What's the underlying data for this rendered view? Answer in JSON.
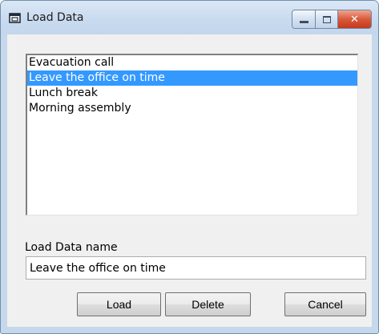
{
  "window": {
    "title": "Load Data",
    "icon": "app-window-icon",
    "controls": {
      "minimize_icon": "minimize-icon",
      "maximize_icon": "maximize-icon",
      "close_symbol": "✕"
    }
  },
  "list": {
    "items": [
      {
        "label": "Evacuation call",
        "selected": false
      },
      {
        "label": "Leave the office on time",
        "selected": true
      },
      {
        "label": "Lunch break",
        "selected": false
      },
      {
        "label": "Morning assembly",
        "selected": false
      }
    ]
  },
  "name_field": {
    "label": "Load Data name",
    "value": "Leave the office on time"
  },
  "buttons": {
    "load": "Load",
    "delete": "Delete",
    "cancel": "Cancel"
  },
  "colors": {
    "selection": "#3399ff",
    "close_button": "#d9593c",
    "titlebar": "#c9dbef"
  }
}
